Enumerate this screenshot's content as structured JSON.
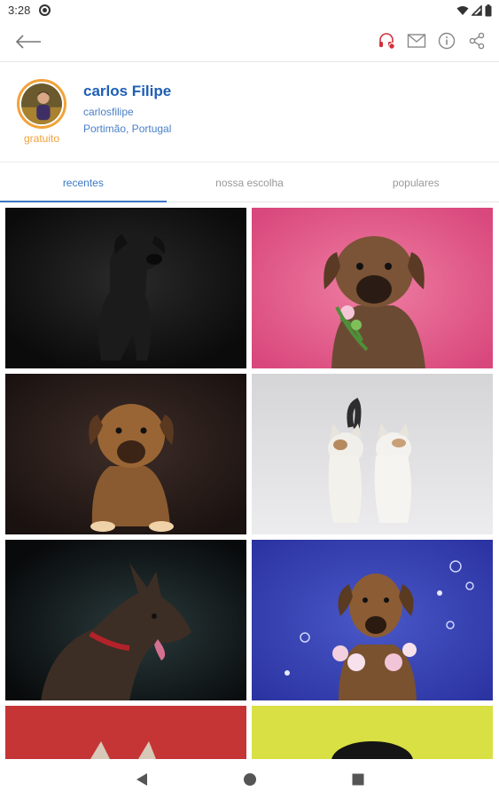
{
  "status_bar": {
    "time": "3:28",
    "icons": [
      "app-notification-icon",
      "wifi-icon",
      "signal-icon",
      "battery-icon"
    ]
  },
  "app_bar": {
    "icons": [
      "back-arrow-icon",
      "support-alert-icon",
      "mail-icon",
      "info-icon",
      "share-icon"
    ]
  },
  "profile": {
    "name": "carlos Filipe",
    "username": "carlosfilipe",
    "location": "Portimão, Portugal",
    "badge": "gratuito",
    "ring_color": "#f2a23a"
  },
  "tabs": [
    {
      "label": "recentes",
      "active": true
    },
    {
      "label": "nossa escolha",
      "active": false
    },
    {
      "label": "populares",
      "active": false
    }
  ],
  "photos": [
    {
      "subject": "black puppy sitting",
      "background": "#141414"
    },
    {
      "subject": "brown puppy with flowers",
      "background": "#e35f8c"
    },
    {
      "subject": "brown fluffy puppy",
      "background": "#2a1d1a"
    },
    {
      "subject": "two white kittens",
      "background": "#dcdcde"
    },
    {
      "subject": "wolf-like dog with red collar",
      "background": "#0f1012"
    },
    {
      "subject": "dog with flower collar",
      "background": "#3640b0"
    },
    {
      "subject": "dog ears on red",
      "background": "#c53535"
    },
    {
      "subject": "dark dog on yellow",
      "background": "#d9e043"
    }
  ],
  "nav_bar": {
    "icons": [
      "back-triangle-icon",
      "home-circle-icon",
      "recents-square-icon"
    ]
  },
  "colors": {
    "accent": "#3c78c3",
    "name": "#1e5fb4",
    "badge": "#f2a23a"
  }
}
